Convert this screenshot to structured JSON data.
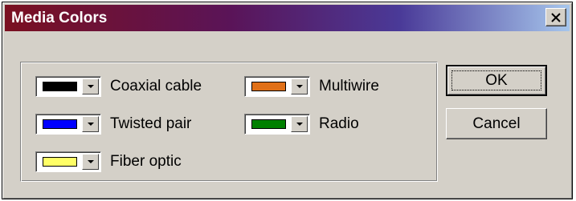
{
  "window": {
    "title": "Media Colors"
  },
  "media": [
    {
      "label": "Coaxial cable",
      "color": "#000000"
    },
    {
      "label": "Twisted pair",
      "color": "#0000ff"
    },
    {
      "label": "Fiber optic",
      "color": "#ffff66"
    },
    {
      "label": "Multiwire",
      "color": "#e07018"
    },
    {
      "label": "Radio",
      "color": "#008000"
    }
  ],
  "buttons": {
    "ok": "OK",
    "cancel": "Cancel"
  },
  "colors": {
    "titlebar_start": "#7a1020",
    "titlebar_end": "#a6c6ec",
    "face": "#d4d0c8"
  }
}
